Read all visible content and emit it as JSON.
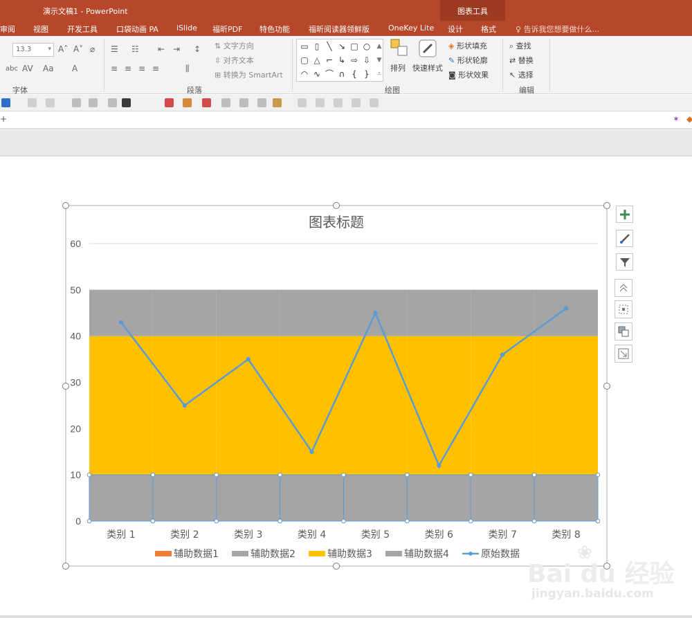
{
  "window": {
    "doc_title": "演示文稿1 - PowerPoint",
    "context_header": "图表工具"
  },
  "tabs": [
    {
      "label": "审阅"
    },
    {
      "label": "视图"
    },
    {
      "label": "开发工具"
    },
    {
      "label": "口袋动画 PA"
    },
    {
      "label": "iSlide"
    },
    {
      "label": "福昕PDF"
    },
    {
      "label": "特色功能"
    },
    {
      "label": "福昕阅读器领鲜版"
    },
    {
      "label": "OneKey Lite"
    },
    {
      "label": "设计"
    },
    {
      "label": "格式"
    }
  ],
  "tell_me": "告诉我您想要做什么...",
  "ribbon": {
    "font_size": "13.3",
    "groups": {
      "font": "字体",
      "paragraph": "段落",
      "drawing": "绘图",
      "editing": "编辑"
    },
    "paragraph": {
      "text_direction": "文字方向",
      "align_text": "对齐文本",
      "convert_smartart": "转换为 SmartArt"
    },
    "drawing": {
      "arrange": "排列",
      "quick_styles": "快速样式",
      "shape_fill": "形状填充",
      "shape_outline": "形状轮廓",
      "shape_effects": "形状效果"
    },
    "editing": {
      "find": "查找",
      "replace": "替换",
      "select": "选择"
    }
  },
  "colors": {
    "accent": "#b7472a",
    "series_orange": "#ed7d31",
    "series_gray": "#a5a5a5",
    "series_gold": "#ffc000",
    "series_line": "#5b9bd5"
  },
  "watermark": {
    "brand": "Bai du 经验",
    "url": "jingyan.baidu.com"
  },
  "chart_data": {
    "type": "bar",
    "title": "图表标题",
    "categories": [
      "类别 1",
      "类别 2",
      "类别 3",
      "类别 4",
      "类别 5",
      "类别 6",
      "类别 7",
      "类别 8"
    ],
    "ylim": [
      0,
      60
    ],
    "yticks": [
      "0",
      "10",
      "20",
      "30",
      "40",
      "50",
      "60"
    ],
    "stacked": true,
    "grid": true,
    "legend_position": "bottom",
    "series": [
      {
        "name": "辅助数据1",
        "type": "stacked-bar",
        "color": "#ed7d31",
        "values": [
          0,
          0,
          0,
          0,
          0,
          0,
          0,
          0
        ]
      },
      {
        "name": "辅助数据2",
        "type": "stacked-bar",
        "color": "#a5a5a5",
        "values": [
          10,
          10,
          10,
          10,
          10,
          10,
          10,
          10
        ]
      },
      {
        "name": "辅助数据3",
        "type": "stacked-bar",
        "color": "#ffc000",
        "values": [
          30,
          30,
          30,
          30,
          30,
          30,
          30,
          30
        ]
      },
      {
        "name": "辅助数据4",
        "type": "stacked-bar",
        "color": "#a5a5a5",
        "values": [
          10,
          10,
          10,
          10,
          10,
          10,
          10,
          10
        ]
      },
      {
        "name": "原始数据",
        "type": "line",
        "color": "#5b9bd5",
        "values": [
          43,
          25,
          35,
          15,
          45,
          12,
          36,
          46
        ]
      }
    ]
  }
}
